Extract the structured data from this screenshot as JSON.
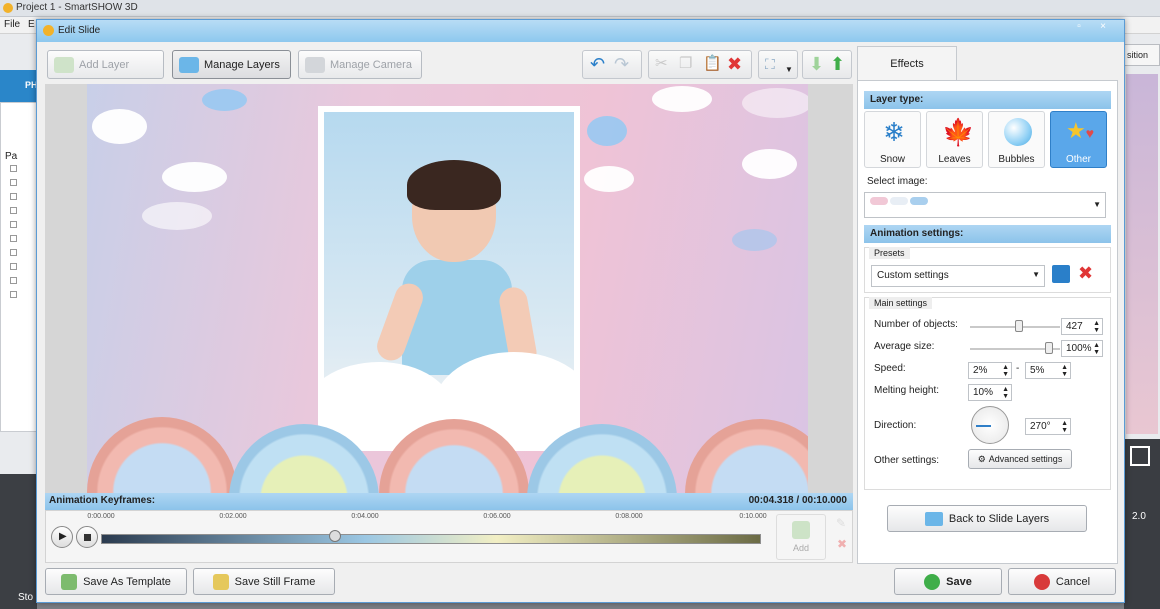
{
  "main_window": {
    "title": "Project 1 - SmartSHOW 3D",
    "menu": [
      "File",
      "E"
    ],
    "left_tab_label": "PH",
    "tree_root": "Pa",
    "right_button_label": "sition",
    "right_number": "2.0",
    "bottom_left_label": "Sto"
  },
  "dialog": {
    "title": "Edit Slide",
    "window_buttons": [
      "▫",
      "×"
    ],
    "toolbar": {
      "add_layer": "Add Layer",
      "manage_layers": "Manage Layers",
      "manage_camera": "Manage Camera"
    },
    "keyframes": {
      "label": "Animation Keyframes:",
      "time": "00:04.318 / 00:10.000",
      "ticks": [
        "0:00.000",
        "0:02.000",
        "0:04.000",
        "0:06.000",
        "0:08.000",
        "0:10.000"
      ],
      "add_label": "Add"
    },
    "bottom": {
      "save_template": "Save As Template",
      "save_still": "Save Still Frame",
      "save": "Save",
      "cancel": "Cancel"
    }
  },
  "effects": {
    "tab_label": "Effects",
    "layer_type_header": "Layer type:",
    "layer_types": [
      {
        "label": "Snow",
        "icon": "snowflake-icon",
        "selected": false
      },
      {
        "label": "Leaves",
        "icon": "leaf-icon",
        "selected": false
      },
      {
        "label": "Bubbles",
        "icon": "bubble-icon",
        "selected": false
      },
      {
        "label": "Other",
        "icon": "star-heart-icon",
        "selected": true
      }
    ],
    "select_image_label": "Select image:",
    "animation_header": "Animation settings:",
    "presets_label": "Presets",
    "preset_value": "Custom settings",
    "main_settings_label": "Main settings",
    "number_of_objects_label": "Number of objects:",
    "number_of_objects": "427",
    "average_size_label": "Average size:",
    "average_size": "100%",
    "speed_label": "Speed:",
    "speed_min": "2%",
    "speed_dash": "-",
    "speed_max": "5%",
    "melting_height_label": "Melting height:",
    "melting_height": "10%",
    "direction_label": "Direction:",
    "direction": "270°",
    "other_settings_label": "Other settings:",
    "advanced_button": "Advanced settings",
    "back_button": "Back to Slide Layers"
  },
  "colors": {
    "accent": "#5aa7ea",
    "header_blue": "#8cc3ea",
    "save_green": "#3fae49",
    "cancel_red": "#d83a3a"
  }
}
